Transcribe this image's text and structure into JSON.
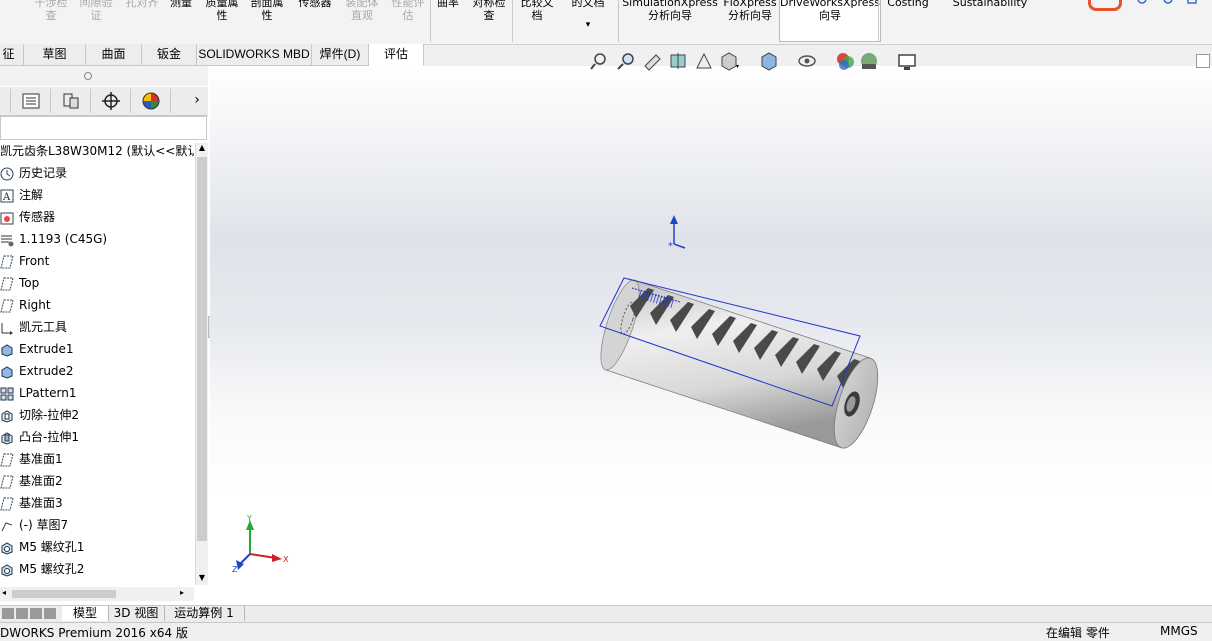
{
  "ribbon": {
    "buttons": [
      {
        "label": "干涉检\n查",
        "enabled": false
      },
      {
        "label": "间隙验\n证",
        "enabled": false
      },
      {
        "label": "孔对齐",
        "enabled": false
      },
      {
        "label": "测量",
        "enabled": true
      },
      {
        "label": "质量属\n性",
        "enabled": true
      },
      {
        "label": "剖面属\n性",
        "enabled": true
      },
      {
        "label": "传感器",
        "enabled": true
      },
      {
        "label": "装配体\n直观",
        "enabled": false
      },
      {
        "label": "性能评\n估",
        "enabled": false
      },
      {
        "label": "曲率",
        "enabled": true
      },
      {
        "label": "对称检\n查",
        "enabled": true
      },
      {
        "label": "比较文\n档",
        "enabled": true
      },
      {
        "label": "的文档",
        "enabled": true
      },
      {
        "label": "SimulationXpress\n分析向导",
        "enabled": true
      },
      {
        "label": "FloXpress\n分析向导",
        "enabled": true
      },
      {
        "label": "DriveWorksXpress\n向导",
        "enabled": true
      },
      {
        "label": "Costing",
        "enabled": true
      },
      {
        "label": "Sustainability",
        "enabled": true
      }
    ]
  },
  "command_tabs": [
    {
      "label": "征"
    },
    {
      "label": "草图"
    },
    {
      "label": "曲面"
    },
    {
      "label": "钣金"
    },
    {
      "label": "SOLIDWORKS MBD"
    },
    {
      "label": "焊件(D)"
    },
    {
      "label": "评估",
      "active": true
    }
  ],
  "feature_manager": {
    "root_label": "凯元齿条L38W30M12  (默认<<默认",
    "items": [
      {
        "label": "历史记录",
        "icon": "history-icon"
      },
      {
        "label": "注解",
        "icon": "annotation-icon"
      },
      {
        "label": "传感器",
        "icon": "sensor-icon"
      },
      {
        "label": "1.1193 (C45G)",
        "icon": "material-icon"
      },
      {
        "label": "Front",
        "icon": "plane-icon"
      },
      {
        "label": "Top",
        "icon": "plane-icon"
      },
      {
        "label": "Right",
        "icon": "plane-icon"
      },
      {
        "label": "凯元工具",
        "icon": "origin-icon"
      },
      {
        "label": "Extrude1",
        "icon": "extrude-icon"
      },
      {
        "label": "Extrude2",
        "icon": "extrude-icon"
      },
      {
        "label": "LPattern1",
        "icon": "pattern-icon"
      },
      {
        "label": "切除-拉伸2",
        "icon": "cut-extrude-icon"
      },
      {
        "label": "凸台-拉伸1",
        "icon": "boss-extrude-icon"
      },
      {
        "label": "基准面1",
        "icon": "plane-icon"
      },
      {
        "label": "基准面2",
        "icon": "plane-icon"
      },
      {
        "label": "基准面3",
        "icon": "plane-icon"
      },
      {
        "label": "(-) 草图7",
        "icon": "sketch-icon"
      },
      {
        "label": "M5 螺纹孔1",
        "icon": "hole-wizard-icon"
      },
      {
        "label": "M5 螺纹孔2",
        "icon": "hole-wizard-icon"
      }
    ]
  },
  "bottom_tabs": [
    {
      "label": "模型",
      "active": true
    },
    {
      "label": "3D 视图"
    },
    {
      "label": "运动算例 1"
    }
  ],
  "status": {
    "app": "DWORKS Premium 2016 x64 版",
    "mode": "在编辑 零件",
    "units": "MMGS"
  },
  "colors": {
    "sketch_blue": "#2233cc",
    "triad_red": "#cc2222",
    "triad_green": "#22aa33",
    "triad_blue": "#2244cc",
    "brand_orange": "#e9502c"
  }
}
